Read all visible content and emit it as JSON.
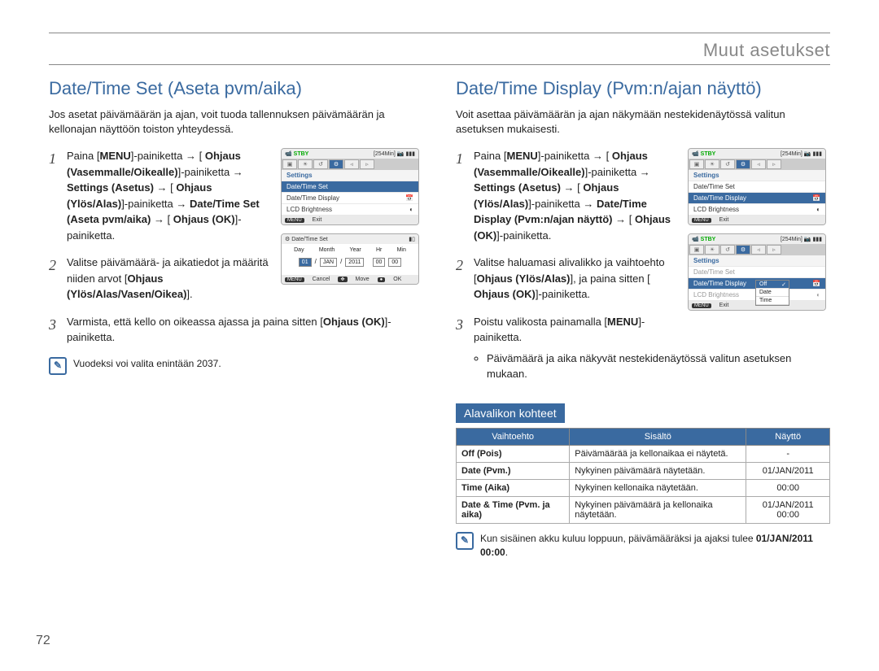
{
  "header": {
    "title": "Muut asetukset"
  },
  "pagenum": "72",
  "left": {
    "heading": "Date/Time Set (Aseta pvm/aika)",
    "intro": "Jos asetat päivämäärän ja ajan, voit tuoda tallennuksen päivämäärän ja kellonajan näyttöön toiston yhteydessä.",
    "steps": {
      "s1_a": "Paina [",
      "s1_b": "MENU",
      "s1_c": "]-painiketta → [",
      "s1_d": "Ohjaus (Vasemmalle/Oikealle)",
      "s1_e": "]-painiketta → ",
      "s1_f": "Settings (Asetus)",
      "s1_g": " → [",
      "s1_h": "Ohjaus (Ylös/Alas)",
      "s1_i": "]-painiketta → ",
      "s1_j": "Date/Time Set (Aseta pvm/aika)",
      "s1_k": " → [",
      "s1_l": "Ohjaus (OK)",
      "s1_m": "]-painiketta.",
      "s2_a": "Valitse päivämäärä- ja aikatiedot ja määritä niiden arvot [",
      "s2_b": "Ohjaus (Ylös/Alas/Vasen/Oikea)",
      "s2_c": "].",
      "s3_a": "Varmista, että kello on oikeassa ajassa ja paina sitten [",
      "s3_b": "Ohjaus (OK)",
      "s3_c": "]-painiketta."
    },
    "note": "Vuodeksi voi valita enintään 2037.",
    "lcd1": {
      "stby": "STBY",
      "time": "[254Min]",
      "bat": "▮▮▮",
      "settings": "Settings",
      "row1": "Date/Time Set",
      "row2": "Date/Time Display",
      "row3": "LCD Brightness",
      "menu": "MENU",
      "exit": "Exit"
    },
    "lcd2": {
      "title": "Date/Time Set",
      "bat": "▮▯",
      "hdr": [
        "Day",
        "Month",
        "Year",
        "Hr",
        "Min"
      ],
      "vals": [
        "01",
        "JAN",
        "2011",
        "00",
        "00"
      ],
      "menu": "MENU",
      "cancel": "Cancel",
      "move": "Move",
      "ok": "OK"
    }
  },
  "right": {
    "heading": "Date/Time Display (Pvm:n/ajan näyttö)",
    "intro": "Voit asettaa päivämäärän ja ajan näkymään nestekidenäytössä valitun asetuksen mukaisesti.",
    "steps": {
      "s1_a": "Paina [",
      "s1_b": "MENU",
      "s1_c": "]-painiketta → [",
      "s1_d": "Ohjaus (Vasemmalle/Oikealle)",
      "s1_e": "]-painiketta → ",
      "s1_f": "Settings (Asetus)",
      "s1_g": " → [",
      "s1_h": "Ohjaus (Ylös/Alas)",
      "s1_i": "]-painiketta → ",
      "s1_j": "Date/Time Display (Pvm:n/ajan näyttö)",
      "s1_k": " → [",
      "s1_l": "Ohjaus (OK)",
      "s1_m": "]-painiketta.",
      "s2_a": "Valitse haluamasi alivalikko ja vaihtoehto [",
      "s2_b": "Ohjaus (Ylös/Alas)",
      "s2_c": "], ja paina sitten [",
      "s2_d": "Ohjaus (OK)",
      "s2_e": "]-painiketta.",
      "s3_a": "Poistu valikosta painamalla [",
      "s3_b": "MENU",
      "s3_c": "]-painiketta.",
      "bullet": "Päivämäärä ja aika näkyvät nestekidenäytössä valitun asetuksen mukaan."
    },
    "lcd1": {
      "stby": "STBY",
      "time": "[254Min]",
      "bat": "▮▮▮",
      "settings": "Settings",
      "row1": "Date/Time Set",
      "row2": "Date/Time Display",
      "row3": "LCD Brightness",
      "menu": "MENU",
      "exit": "Exit"
    },
    "lcd2": {
      "stby": "STBY",
      "time": "[254Min]",
      "bat": "▮▮▮",
      "settings": "Settings",
      "row1": "Date/Time Set",
      "row2": "Date/Time Display",
      "row3": "LCD Brightness",
      "pop": [
        "Off",
        "Date",
        "Time"
      ],
      "menu": "MENU",
      "exit": "Exit"
    },
    "sub_banner": "Alavalikon kohteet",
    "table": {
      "headers": [
        "Vaihtoehto",
        "Sisältö",
        "Näyttö"
      ],
      "rows": [
        {
          "opt": "Off (Pois)",
          "desc": "Päivämäärää ja kellonaikaa ei näytetä.",
          "disp": "-"
        },
        {
          "opt": "Date (Pvm.)",
          "desc": "Nykyinen päivämäärä näytetään.",
          "disp": "01/JAN/2011"
        },
        {
          "opt": "Time (Aika)",
          "desc": "Nykyinen kellonaika näytetään.",
          "disp": "00:00"
        },
        {
          "opt": "Date & Time (Pvm. ja aika)",
          "desc": "Nykyinen päivämäärä ja kellonaika näytetään.",
          "disp": "01/JAN/2011 00:00"
        }
      ]
    },
    "note_a": "Kun sisäinen akku kuluu loppuun, päivämääräksi ja ajaksi tulee ",
    "note_b": "01/JAN/2011 00:00",
    "note_c": "."
  }
}
